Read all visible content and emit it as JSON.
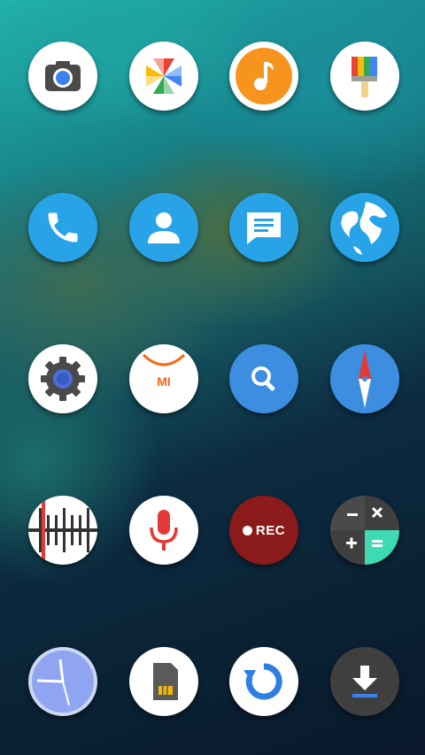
{
  "screen": "home-screen-app-grid",
  "colors": {
    "white_bg": "#ffffff",
    "blue_bg": "#29a3e8",
    "orange_bg": "#f7941d",
    "red_accent": "#e53935",
    "rec_bg": "#8b1a1a",
    "dark_bg": "#3f3f3f"
  },
  "apps": [
    {
      "name": "camera",
      "icon": "camera-icon"
    },
    {
      "name": "photos",
      "icon": "pinwheel-icon"
    },
    {
      "name": "music",
      "icon": "music-note-icon"
    },
    {
      "name": "theme",
      "icon": "paintbrush-icon"
    },
    {
      "name": "phone",
      "icon": "phone-icon"
    },
    {
      "name": "contacts",
      "icon": "person-icon"
    },
    {
      "name": "messages",
      "icon": "message-icon"
    },
    {
      "name": "browser",
      "icon": "globe-icon"
    },
    {
      "name": "settings",
      "icon": "gear-icon"
    },
    {
      "name": "mi-store",
      "icon": "mi-bag-icon",
      "label": "MI"
    },
    {
      "name": "search",
      "icon": "search-icon"
    },
    {
      "name": "compass",
      "icon": "compass-icon"
    },
    {
      "name": "fm-radio",
      "icon": "radio-tuner-icon"
    },
    {
      "name": "voice-recorder",
      "icon": "microphone-icon"
    },
    {
      "name": "screen-recorder",
      "icon": "rec-icon",
      "label": "REC"
    },
    {
      "name": "calculator",
      "icon": "calculator-icon"
    },
    {
      "name": "clock",
      "icon": "clock-icon"
    },
    {
      "name": "sim-toolkit",
      "icon": "sim-card-icon"
    },
    {
      "name": "updater",
      "icon": "refresh-icon"
    },
    {
      "name": "downloads",
      "icon": "download-icon"
    }
  ]
}
